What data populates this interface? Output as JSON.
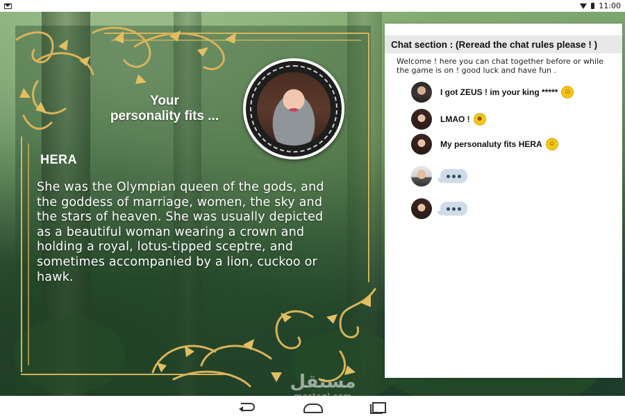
{
  "status_bar": {
    "time": "11:00",
    "icons": [
      "gmail-icon",
      "wifi-icon",
      "battery-icon"
    ]
  },
  "personality": {
    "heading_line1": "Your",
    "heading_line2": "personality fits ...",
    "name": "HERA",
    "description": "She was the Olympian queen of the gods, and the goddess of marriage, women, the sky and the stars of heaven. She was usually depicted as a beautiful woman wearing a crown and holding a royal, lotus-tipped sceptre, and sometimes accompanied by a lion, cuckoo or hawk."
  },
  "chat": {
    "title": "Chat section : (Reread the chat rules please ! )",
    "welcome": "Welcome ! here you can chat together before or while the game is on ! good luck and have fun .",
    "messages": [
      {
        "text": "I got ZEUS ! im your king *****",
        "emoji": "☺",
        "emoji_name": "smiley-emoji",
        "avatar": "man-avatar",
        "typing": false
      },
      {
        "text": "LMAO !",
        "emoji": "☻",
        "emoji_name": "laughing-emoji",
        "avatar": "woman-avatar",
        "typing": false
      },
      {
        "text": "My personaluty fits HERA",
        "emoji": "☺",
        "emoji_name": "blush-emoji",
        "avatar": "woman-avatar",
        "typing": false
      },
      {
        "text": "",
        "avatar": "man-avatar-2",
        "typing": true
      },
      {
        "text": "",
        "avatar": "woman-avatar",
        "typing": true
      }
    ]
  },
  "watermark": {
    "logo": "مستقل",
    "site": "mostaql.com"
  },
  "nav_bar": {
    "icons": [
      "back-icon",
      "home-icon",
      "recents-icon"
    ]
  },
  "colors": {
    "gold": "#d9b35a",
    "chat_header_bg": "#e8e8e8",
    "typing_bubble": "#cfdbe8"
  }
}
